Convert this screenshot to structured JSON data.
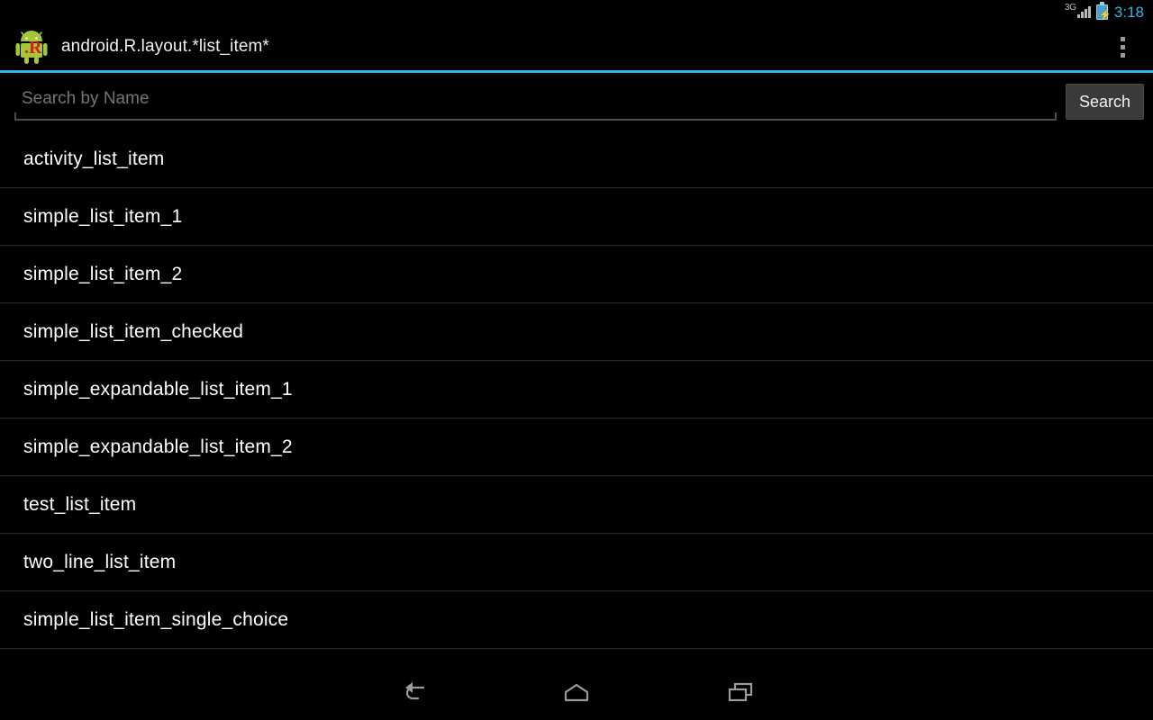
{
  "status_bar": {
    "network_label": "3G",
    "signal_icon": "signal-bars-icon",
    "battery_icon": "battery-charging-icon",
    "time": "3:18",
    "accent_color": "#33b5e5"
  },
  "action_bar": {
    "app_icon": "android-robot-icon",
    "app_icon_badge": ".R",
    "title": "android.R.layout.*list_item*",
    "overflow_icon": "overflow-menu-icon",
    "underline_color": "#33b5e5"
  },
  "search": {
    "placeholder": "Search by Name",
    "value": "",
    "button_label": "Search"
  },
  "list": {
    "items": [
      {
        "label": "activity_list_item"
      },
      {
        "label": "simple_list_item_1"
      },
      {
        "label": "simple_list_item_2"
      },
      {
        "label": "simple_list_item_checked"
      },
      {
        "label": "simple_expandable_list_item_1"
      },
      {
        "label": "simple_expandable_list_item_2"
      },
      {
        "label": "test_list_item"
      },
      {
        "label": "two_line_list_item"
      },
      {
        "label": "simple_list_item_single_choice"
      }
    ]
  },
  "nav_bar": {
    "buttons": [
      {
        "name": "back-icon"
      },
      {
        "name": "home-icon"
      },
      {
        "name": "recents-icon"
      }
    ]
  }
}
